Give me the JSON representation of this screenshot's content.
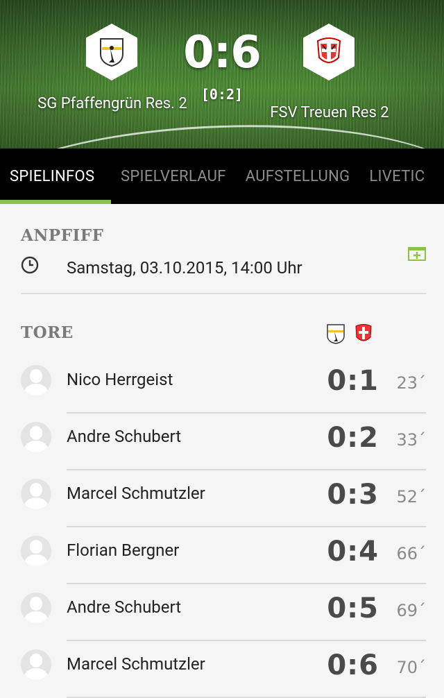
{
  "match": {
    "home_team": "SG Pfaffengrün Res. 2",
    "away_team": "FSV Treuen Res 2",
    "score": "0:6",
    "halftime": "[0:2]"
  },
  "tabs": [
    {
      "label": "SPIELINFOS",
      "active": true
    },
    {
      "label": "SPIELVERLAUF",
      "active": false
    },
    {
      "label": "AUFSTELLUNG",
      "active": false
    },
    {
      "label": "LIVETIC",
      "active": false
    }
  ],
  "kickoff": {
    "title": "ANPFIFF",
    "datetime": "Samstag, 03.10.2015, 14:00 Uhr",
    "icon": "clock-icon",
    "action_icon": "add-to-calendar-icon"
  },
  "goals": {
    "title": "TORE",
    "list": [
      {
        "player": "Nico Herrgeist",
        "score": "0:1",
        "minute": "23´"
      },
      {
        "player": "Andre Schubert",
        "score": "0:2",
        "minute": "33´"
      },
      {
        "player": "Marcel Schmutzler",
        "score": "0:3",
        "minute": "52´"
      },
      {
        "player": "Florian Bergner",
        "score": "0:4",
        "minute": "66´"
      },
      {
        "player": "Andre Schubert",
        "score": "0:5",
        "minute": "69´"
      },
      {
        "player": "Marcel Schmutzler",
        "score": "0:6",
        "minute": "70´"
      }
    ]
  },
  "colors": {
    "accent": "#8bc34a",
    "tab_bar": "#000000",
    "score_text": "#4a4a4a"
  }
}
